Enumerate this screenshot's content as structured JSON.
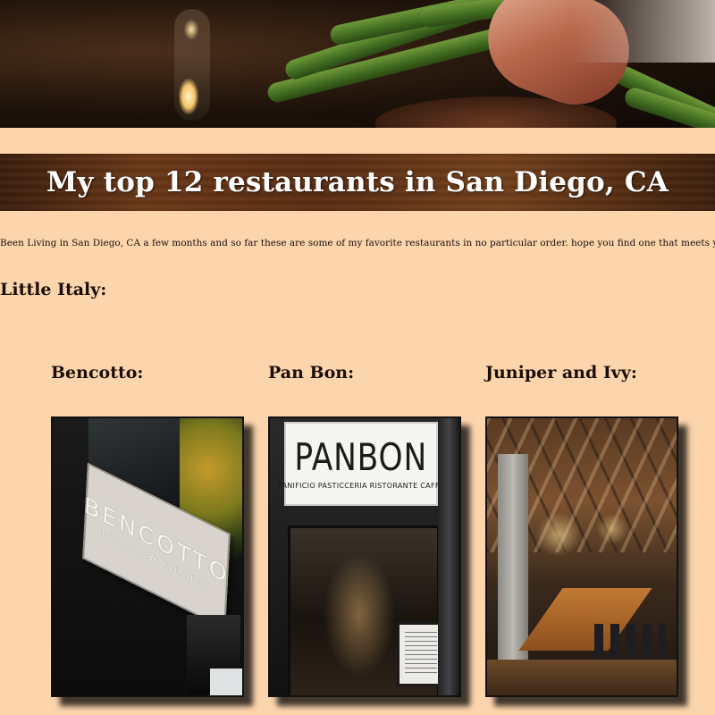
{
  "page": {
    "title": "My top 12 restaurants in San Diego, CA",
    "intro": "Been Living in San Diego, CA a few months and so far these are some of my favorite restaurants in no particular order. hope you find one that meets your needs and enjoy them as I did."
  },
  "section": {
    "title": "Little Italy:",
    "restaurants": [
      {
        "name": "Bencotto:",
        "photo_sign": "BENCOTTO",
        "photo_subsign": "ITALIAN ✿ KITCHEN"
      },
      {
        "name": "Pan Bon:",
        "photo_sign": "PANBON",
        "photo_subsign": "PANIFICIO PASTICCERIA RISTORANTE CAFFE"
      },
      {
        "name": "Juniper and Ivy:"
      }
    ]
  },
  "colors": {
    "background": "#fdd5ad",
    "title_bar": "#5a2d12",
    "title_text": "#ffffff"
  }
}
